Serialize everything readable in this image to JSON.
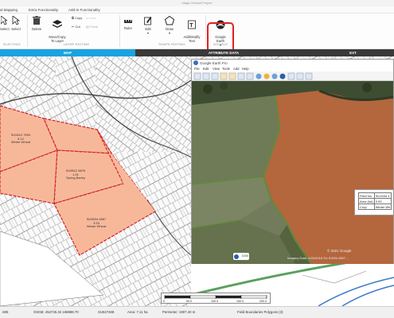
{
  "window": {
    "title": "Magic Default Project"
  },
  "menu": {
    "items": [
      "al Mapping",
      "Extra Functionality",
      "Add-In Functionality"
    ]
  },
  "ribbon": {
    "select_label": "Select",
    "select_dropdown_label": "Select",
    "selecting_group": "ELECTING",
    "delete_label": "Delete",
    "move_copy_label": "Move/Copy\nTo Layer",
    "copy_label": "Copy",
    "cut_label": "Cut",
    "paste_label": "Paste",
    "layer_editing_group": "LAYER EDITING",
    "ruler_label": "Ruler",
    "edit_label": "Edit",
    "draw_label": "Draw",
    "add_modify_text_label": "Add/Modify\nText",
    "shape_editing_group": "SHAPE EDITING",
    "google_earth_label": "Google\nEarth",
    "google_group": "GOOGLE"
  },
  "tabs": {
    "map": "MAP",
    "attribute_data": "ATTRIBUTE DATA",
    "ext": "EXT"
  },
  "parcels": [
    {
      "id": "SU5412 7654",
      "area": "5.12",
      "crop": "Winter Wheat"
    },
    {
      "id": "SU5512 6876",
      "area": "1.91",
      "crop": "Spring Barley"
    },
    {
      "id": "SU5534 4567",
      "area": "3.93",
      "crop": "Winter Wheat"
    }
  ],
  "google_earth": {
    "title": "Google Earth Pro",
    "menu": [
      "File",
      "Edit",
      "View",
      "Tools",
      "Add",
      "Help"
    ],
    "copyright": "© 2021 Google",
    "imagery_text": "Imagery Date: 4/20/2018     SU 51534 4567 ...",
    "logo_text": "1000",
    "popup": {
      "rows": [
        {
          "k": "Field No.",
          "v": "SU1534 4"
        },
        {
          "k": "Area (ha)",
          "v": "3.93"
        },
        {
          "k": "Crop",
          "v": "Winter Wh"
        }
      ]
    }
  },
  "scale": {
    "ticks": [
      "0",
      "50.0",
      "100.0",
      "150.0",
      "200.0"
    ]
  },
  "status": {
    "coord1": ".505",
    "osgb": "OSGB: 452745.32  168888.70",
    "grid": "SU527468",
    "area": "Area: 7.11 ha",
    "perimeter": "Perimeter: 1907.20 m",
    "layer": "Field Boundaries Polygons (3)"
  },
  "colors": {
    "parcel_fill": "#f7b89a",
    "parcel_border": "#d2232a",
    "tab_active": "#1aa3e0",
    "highlight": "#e02020"
  }
}
